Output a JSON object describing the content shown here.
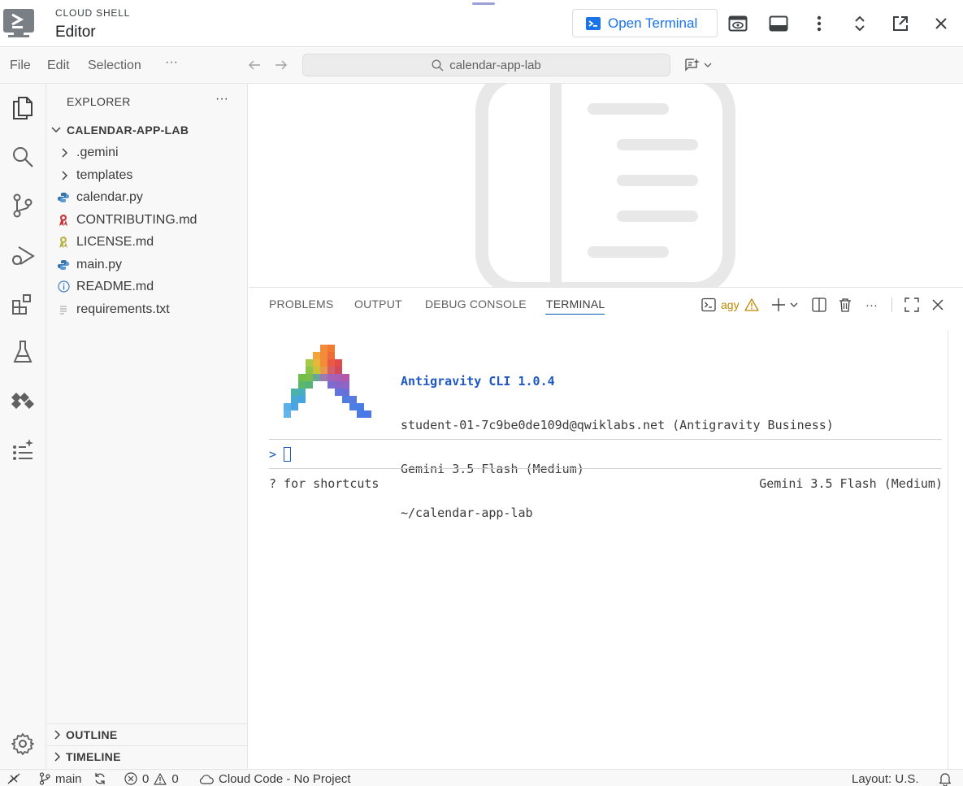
{
  "header": {
    "app_label": "CLOUD SHELL",
    "title": "Editor",
    "open_terminal_label": "Open Terminal"
  },
  "menubar": {
    "items": [
      "File",
      "Edit",
      "Selection"
    ],
    "search_text": "calendar-app-lab"
  },
  "sidebar": {
    "heading": "EXPLORER",
    "root_folder": "CALENDAR-APP-LAB",
    "entries": [
      {
        "label": ".gemini",
        "kind": "folder"
      },
      {
        "label": "templates",
        "kind": "folder"
      },
      {
        "label": "calendar.py",
        "kind": "python"
      },
      {
        "label": "CONTRIBUTING.md",
        "kind": "ribbon-red"
      },
      {
        "label": "LICENSE.md",
        "kind": "ribbon-yellow"
      },
      {
        "label": "main.py",
        "kind": "python"
      },
      {
        "label": "README.md",
        "kind": "info"
      },
      {
        "label": "requirements.txt",
        "kind": "text"
      }
    ],
    "outline_label": "OUTLINE",
    "timeline_label": "TIMELINE"
  },
  "panel": {
    "tabs": [
      "PROBLEMS",
      "OUTPUT",
      "DEBUG CONSOLE",
      "TERMINAL"
    ],
    "active_tab": "TERMINAL",
    "terminal_name": "agy"
  },
  "terminal": {
    "title": "Antigravity CLI 1.0.4",
    "account": "student-01-7c9be0de109d@qwiklabs.net (Antigravity Business)",
    "model": "Gemini 3.5 Flash (Medium)",
    "path": "~/calendar-app-lab",
    "prompt": ">",
    "hint": "? for shortcuts",
    "model_status": "Gemini 3.5 Flash (Medium)"
  },
  "status": {
    "branch": "main",
    "errors": "0",
    "warnings": "0",
    "cloud_code": "Cloud Code - No Project",
    "layout": "Layout: U.S."
  },
  "colors": {
    "accent": "#1a73e8",
    "terminal_title": "#1f57c3",
    "tab_underline": "#005fb8",
    "warning": "#bf8803"
  }
}
